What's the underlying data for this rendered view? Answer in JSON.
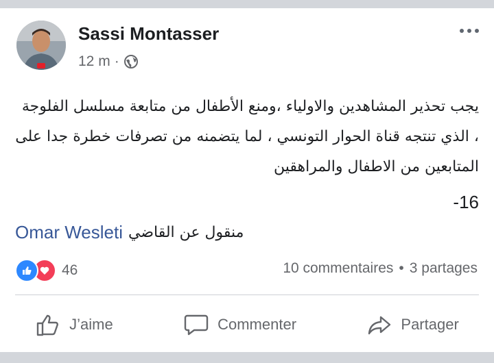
{
  "post": {
    "author": "Sassi Montasser",
    "time": "12 m",
    "separator": "·",
    "audience_icon": "globe-icon",
    "text": "يجب تحذير المشاهدين  والاولياء ،ومنع الأطفال من متابعة مسلسل الفلوجة ، الذي تنتجه قناة الحوار التونسي ، لما يتضمنه من تصرفات خطرة جدا على المتابعين من الاطفال والمراهقين",
    "age_line": "-16",
    "citation_name": "Omar Wesleti",
    "citation_text": "منقول عن القاضي"
  },
  "reactions": {
    "count": "46",
    "types": [
      "like",
      "love"
    ]
  },
  "stats": {
    "comments": "10 commentaires",
    "dot": "•",
    "shares": "3 partages"
  },
  "actions": {
    "like": "J’aime",
    "comment": "Commenter",
    "share": "Partager"
  },
  "colors": {
    "like_blue": "#2d88ff",
    "love_red": "#f33e58",
    "link_blue": "#385898",
    "meta_gray": "#65676b"
  }
}
